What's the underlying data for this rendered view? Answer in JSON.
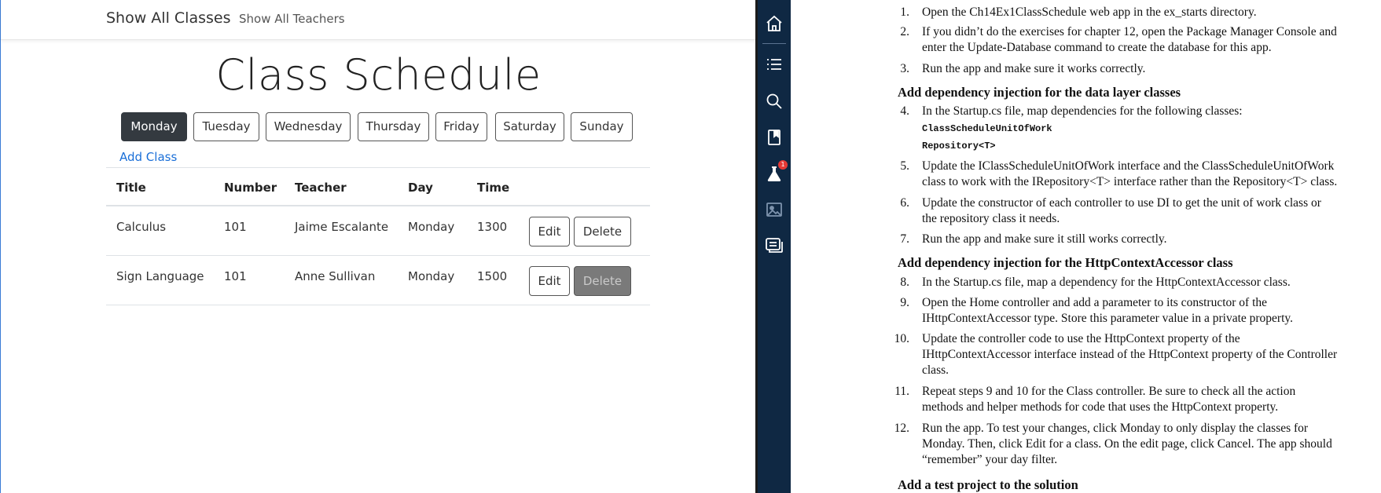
{
  "app": {
    "nav": {
      "brand": "Show All Classes",
      "teachers_link": "Show All Teachers"
    },
    "title": "Class Schedule",
    "days": [
      "Monday",
      "Tuesday",
      "Wednesday",
      "Thursday",
      "Friday",
      "Saturday",
      "Sunday"
    ],
    "active_day": "Monday",
    "add_class": "Add Class",
    "table": {
      "headers": [
        "Title",
        "Number",
        "Teacher",
        "Day",
        "Time"
      ],
      "rows": [
        {
          "title": "Calculus",
          "number": "101",
          "teacher": "Jaime Escalante",
          "day": "Monday",
          "time": "1300",
          "edit": "Edit",
          "delete": "Delete"
        },
        {
          "title": "Sign Language",
          "number": "101",
          "teacher": "Anne Sullivan",
          "day": "Monday",
          "time": "1500",
          "edit": "Edit",
          "delete": "Delete"
        }
      ]
    }
  },
  "sidebar": {
    "icons": [
      "home-icon",
      "list-icon",
      "search-icon",
      "bookmark-icon",
      "flask-icon",
      "image-icon",
      "notes-icon"
    ],
    "badge": "1"
  },
  "doc": {
    "s1": {
      "num": "1.",
      "lines": [
        "Open the Ch14Ex1ClassSchedule web app in the ex_starts directory."
      ]
    },
    "s2": {
      "num": "2.",
      "lines": [
        "If you didn’t do the exercises for chapter 12, open the Package Manager Console and",
        "enter the Update-Database command to create the database for this app."
      ]
    },
    "s3": {
      "num": "3.",
      "lines": [
        "Run the app and make sure it works correctly."
      ]
    },
    "h1": "Add dependency injection for the data layer classes",
    "s4": {
      "num": "4.",
      "lines": [
        "In the Startup.cs file, map dependencies for the following classes:"
      ]
    },
    "code": [
      "ClassScheduleUnitOfWork",
      "Repository<T>"
    ],
    "s5": {
      "num": "5.",
      "lines": [
        "Update the IClassScheduleUnitOfWork interface and the ClassScheduleUnitOfWork",
        "class to work with the IRepository<T> interface rather than the Repository<T> class."
      ]
    },
    "s6": {
      "num": "6.",
      "lines": [
        "Update the constructor of each controller to use DI to get the unit of work class or",
        "the repository class it needs."
      ]
    },
    "s7": {
      "num": "7.",
      "lines": [
        "Run the app and make sure it still works correctly."
      ]
    },
    "h2": "Add dependency injection for the HttpContextAccessor class",
    "s8": {
      "num": "8.",
      "lines": [
        "In the Startup.cs file, map a dependency for the HttpContextAccessor class."
      ]
    },
    "s9": {
      "num": "9.",
      "lines": [
        "Open the Home controller and add a parameter to its constructor of the",
        "IHttpContextAccessor type. Store this parameter value in a private property."
      ]
    },
    "s10": {
      "num": "10.",
      "lines": [
        "Update the controller code to use the HttpContext property of the",
        "IHttpContextAccessor interface instead of the HttpContext property of the Controller",
        "class."
      ]
    },
    "s11": {
      "num": "11.",
      "lines": [
        "Repeat steps 9 and 10 for the Class controller. Be sure to check all the action",
        "methods and helper methods for code that uses the HttpContext property."
      ]
    },
    "s12": {
      "num": "12.",
      "lines": [
        "Run the app. To test your changes, click Monday to only display the classes for",
        "Monday. Then, click Edit for a class. On the edit page, click Cancel. The app should",
        "“remember” your day filter."
      ]
    },
    "h3": "Add a test project to the solution"
  }
}
